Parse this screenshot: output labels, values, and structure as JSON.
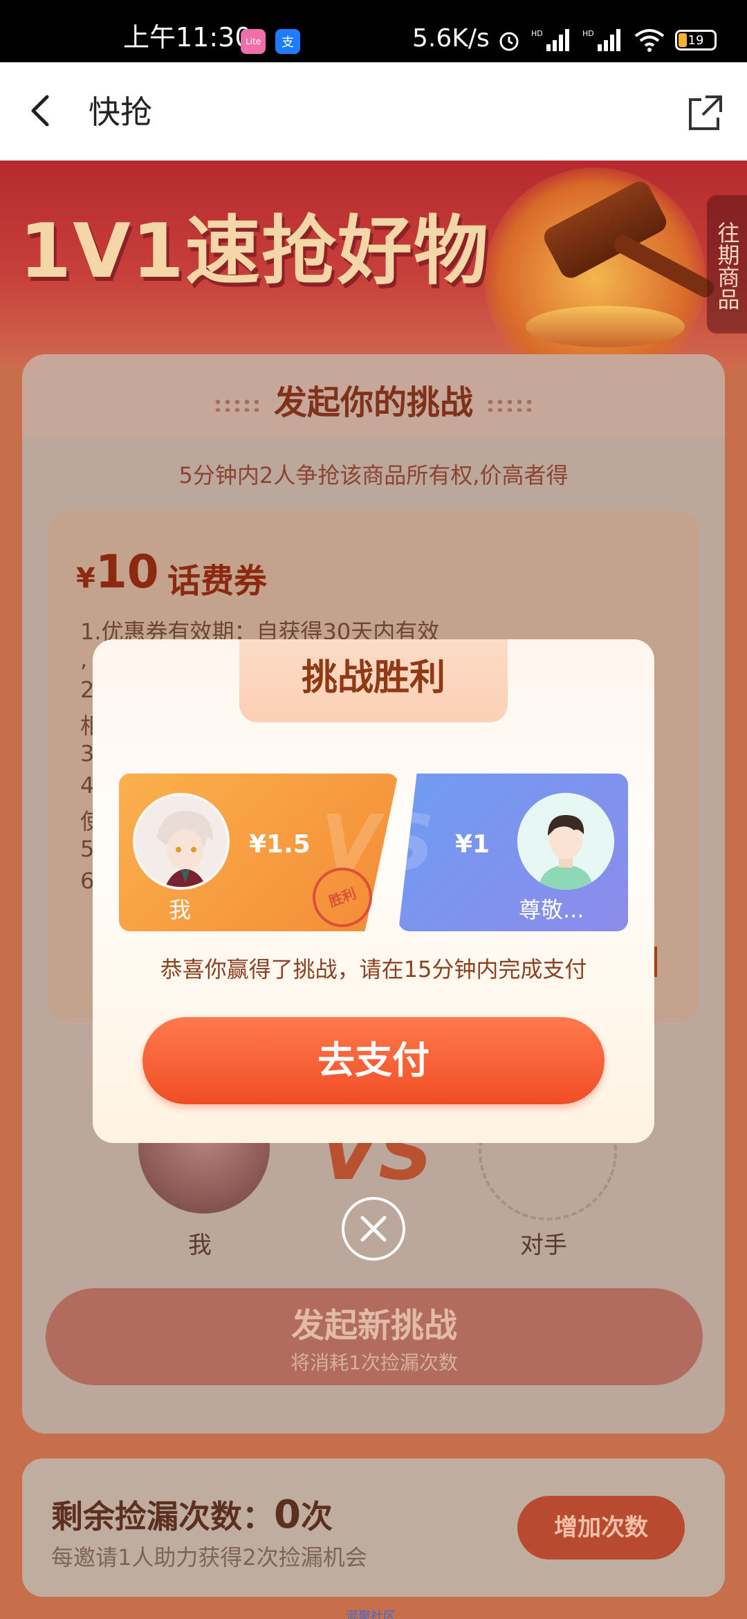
{
  "status_bar": {
    "time": "上午11:30",
    "app1": "Lite",
    "app2": "支",
    "net_speed": "5.6K/s",
    "battery": "19"
  },
  "nav": {
    "title": "快抢"
  },
  "banner": {
    "title": "1V1速抢好物",
    "side_tab": "往期商品"
  },
  "challenge": {
    "title": "发起你的挑战",
    "subtitle": "5分钟内2人争抢该商品所有权,价高者得",
    "prize": {
      "currency": "¥",
      "amount": "10",
      "name": "话费券",
      "lines": [
        "1.优惠券有效期：自获得30天内有效",
        ",",
        "2",
        "相",
        "3",
        "4",
        "使",
        "5",
        "6"
      ]
    },
    "vs": {
      "me_label": "我",
      "vs_text": "VS",
      "opponent_label": "对手"
    },
    "new_challenge": {
      "label": "发起新挑战",
      "sub": "将消耗1次捡漏次数"
    }
  },
  "bottom": {
    "remaining_label": "剩余捡漏次数：",
    "remaining_count": "0",
    "remaining_unit": "次",
    "invite_text": "每邀请1人助力获得2次捡漏机会",
    "add_button": "增加次数",
    "footer_link": "混聚社区"
  },
  "modal": {
    "title": "挑战胜利",
    "me": {
      "price": "¥1.5",
      "name": "我",
      "stamp": "胜利"
    },
    "opponent": {
      "price": "¥1",
      "name": "尊敬..."
    },
    "vs_text": "VS",
    "message": "恭喜你赢得了挑战，请在15分钟内完成支付",
    "pay_button": "去支付"
  },
  "colors": {
    "accent": "#f04d25",
    "winner_panel": "#f38b36",
    "loser_panel": "#6f9cf2"
  }
}
